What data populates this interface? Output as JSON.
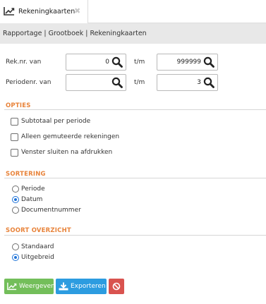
{
  "tab": {
    "label": "Rekeningkaarten",
    "close_glyph": "✖"
  },
  "breadcrumb": "Rapportage | Grootboek | Rekeningkaarten",
  "filters": {
    "account": {
      "label": "Rek.nr. van",
      "from_value": "0",
      "to_label": "t/m",
      "to_value": "999999"
    },
    "period": {
      "label": "Periodenr. van",
      "from_value": "",
      "to_label": "t/m",
      "to_value": "3"
    }
  },
  "options": {
    "title": "OPTIES",
    "items": [
      {
        "label": "Subtotaal per periode",
        "checked": false
      },
      {
        "label": "Alleen gemuteerde rekeningen",
        "checked": false
      },
      {
        "label": "Venster sluiten na afdrukken",
        "checked": false
      }
    ]
  },
  "sorting": {
    "title": "SORTERING",
    "items": [
      {
        "label": "Periode",
        "selected": false
      },
      {
        "label": "Datum",
        "selected": true
      },
      {
        "label": "Documentnummer",
        "selected": false
      }
    ]
  },
  "overview": {
    "title": "SOORT OVERZICHT",
    "items": [
      {
        "label": "Standaard",
        "selected": false
      },
      {
        "label": "Uitgebreid",
        "selected": true
      }
    ]
  },
  "buttons": {
    "show": "Weergeven",
    "export": "Exporteren"
  },
  "icons": {
    "tab": "line-chart-icon",
    "search": "search-icon",
    "show": "line-chart-icon",
    "export": "download-icon",
    "cancel": "ban-icon"
  },
  "colors": {
    "section_title": "#e8833a",
    "radio_selected": "#1e73d8",
    "button_show": "#73be5a",
    "button_export": "#2c9ce0",
    "button_cancel": "#d9534f"
  }
}
